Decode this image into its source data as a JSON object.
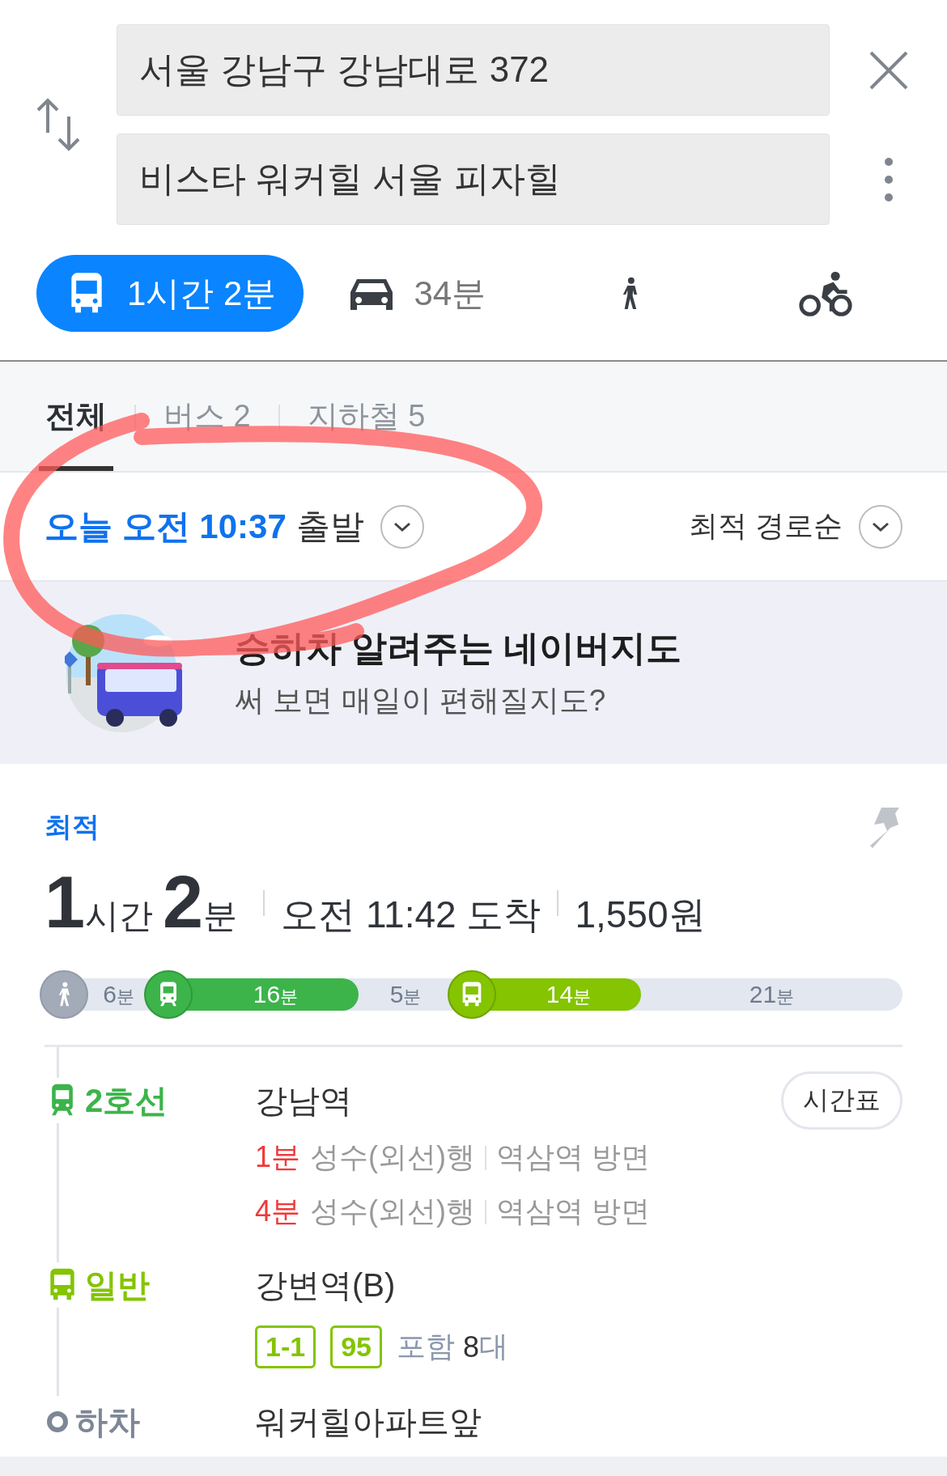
{
  "route_search": {
    "origin": "서울 강남구 강남대로 372",
    "destination": "비스타 워커힐 서울 피자힐"
  },
  "modes": [
    {
      "kind": "transit",
      "label": "1시간 2분",
      "selected": true
    },
    {
      "kind": "car",
      "label": "34분",
      "selected": false
    },
    {
      "kind": "walk",
      "selected": false
    },
    {
      "kind": "bike",
      "selected": false
    }
  ],
  "filter_tabs": [
    {
      "label": "전체",
      "selected": true
    },
    {
      "label": "버스 2",
      "selected": false
    },
    {
      "label": "지하철 5",
      "selected": false
    }
  ],
  "departure": {
    "time": "오늘 오전 10:37",
    "label": "출발",
    "sort": "최적 경로순"
  },
  "banner": {
    "title": "승하차 알려주는 네이버지도",
    "subtitle": "써 보면 매일이 편해질지도?"
  },
  "route": {
    "badge": "최적",
    "duration": [
      {
        "value": "1",
        "unit": "시간"
      },
      {
        "value": "2",
        "unit": "분"
      }
    ],
    "arrival": "오전 11:42 도착",
    "fare": "1,550원",
    "segments": [
      {
        "kind": "walk",
        "value": "6",
        "unit": "분"
      },
      {
        "kind": "subway",
        "value": "16",
        "unit": "분"
      },
      {
        "kind": "walk",
        "value": "5",
        "unit": "분"
      },
      {
        "kind": "bus",
        "value": "14",
        "unit": "분"
      },
      {
        "kind": "walk",
        "value": "21",
        "unit": "분"
      }
    ],
    "steps": [
      {
        "kind": "subway",
        "line": "2호선",
        "station": "강남역",
        "button": "시간표",
        "arrivals": [
          {
            "wait": "1분",
            "direction": "성수(외선)행",
            "heading": "역삼역 방면"
          },
          {
            "wait": "4분",
            "direction": "성수(외선)행",
            "heading": "역삼역 방면"
          }
        ]
      },
      {
        "kind": "bus",
        "line": "일반",
        "station": "강변역(B)",
        "buses": [
          "1-1",
          "95"
        ],
        "included": "포함",
        "count": "8",
        "count_unit": "대"
      },
      {
        "kind": "alight",
        "line": "하차",
        "station": "워커힐아파트앞"
      }
    ]
  },
  "annotation": {
    "kind": "freehand-loop"
  }
}
